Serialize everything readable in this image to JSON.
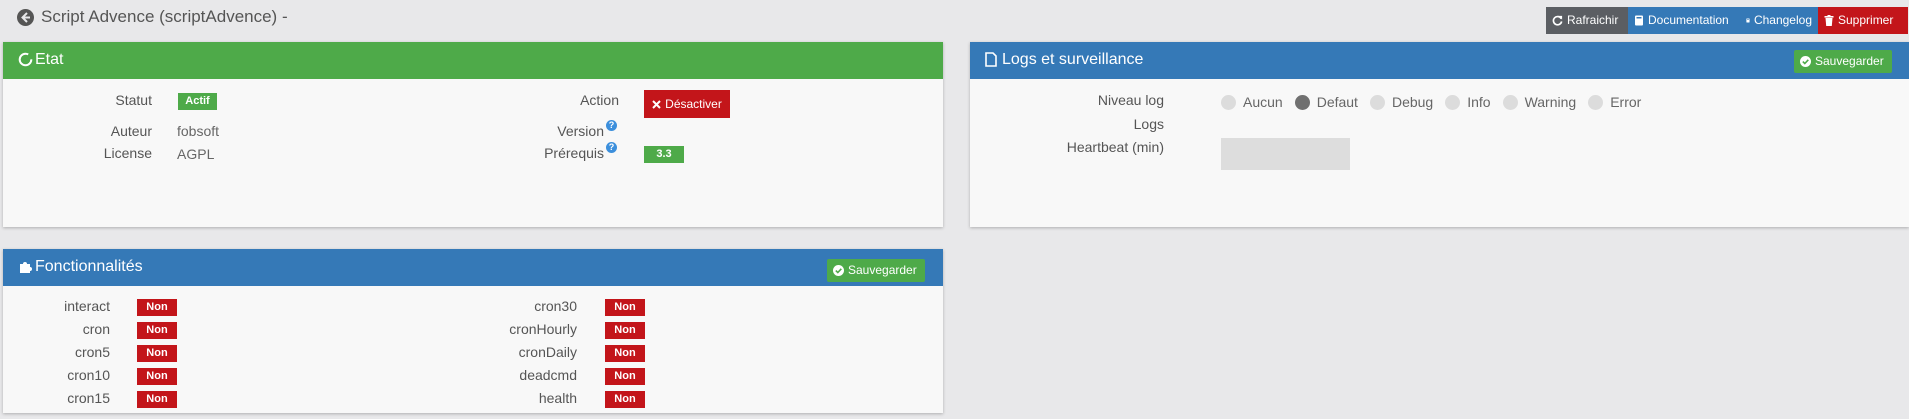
{
  "header": {
    "title": "Script Advence (scriptAdvence) -",
    "buttons": {
      "refresh": "Rafraichir",
      "documentation": "Documentation",
      "changelog": "Changelog",
      "delete": "Supprimer"
    }
  },
  "etat": {
    "title": "Etat",
    "statut_label": "Statut",
    "statut_value": "Actif",
    "auteur_label": "Auteur",
    "auteur_value": "fobsoft",
    "license_label": "License",
    "license_value": "AGPL",
    "action_label": "Action",
    "action_button": "Désactiver",
    "version_label": "Version",
    "prerequis_label": "Prérequis",
    "prerequis_value": "3.3"
  },
  "logs": {
    "title": "Logs et surveillance",
    "save": "Sauvegarder",
    "niveau_label": "Niveau log",
    "levels": [
      {
        "label": "Aucun",
        "selected": false
      },
      {
        "label": "Defaut",
        "selected": true
      },
      {
        "label": "Debug",
        "selected": false
      },
      {
        "label": "Info",
        "selected": false
      },
      {
        "label": "Warning",
        "selected": false
      },
      {
        "label": "Error",
        "selected": false
      }
    ],
    "logs_label": "Logs",
    "heartbeat_label": "Heartbeat (min)",
    "heartbeat_value": ""
  },
  "features": {
    "title": "Fonctionnalités",
    "save": "Sauvegarder",
    "left": [
      {
        "label": "interact",
        "value": "Non"
      },
      {
        "label": "cron",
        "value": "Non"
      },
      {
        "label": "cron5",
        "value": "Non"
      },
      {
        "label": "cron10",
        "value": "Non"
      },
      {
        "label": "cron15",
        "value": "Non"
      }
    ],
    "right": [
      {
        "label": "cron30",
        "value": "Non"
      },
      {
        "label": "cronHourly",
        "value": "Non"
      },
      {
        "label": "cronDaily",
        "value": "Non"
      },
      {
        "label": "deadcmd",
        "value": "Non"
      },
      {
        "label": "health",
        "value": "Non"
      }
    ]
  },
  "colors": {
    "green": "#4eaa49",
    "blue": "#3579b7",
    "red": "#c3151a",
    "gray": "#5b5e63"
  }
}
